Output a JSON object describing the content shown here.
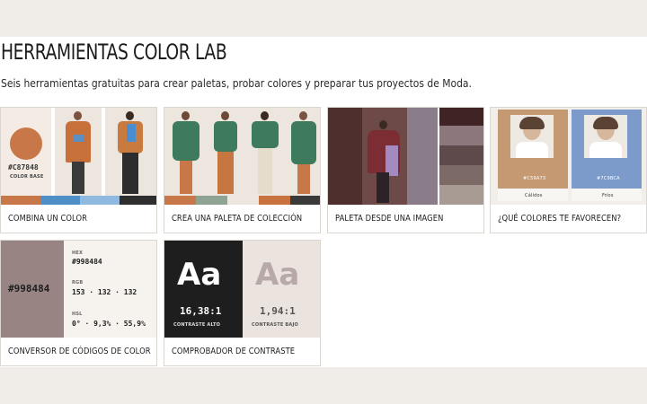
{
  "page": {
    "title": "HERRAMIENTAS COLOR LAB",
    "subtitle": "Seis herramientas gratuitas para crear paletas, probar colores y preparar tus proyectos de Moda."
  },
  "cards": [
    {
      "label": "COMBINA UN COLOR",
      "hex": "#C87848",
      "base": "COLOR BASE"
    },
    {
      "label": "CREA UNA PALETA DE COLECCIÓN"
    },
    {
      "label": "PALETA DESDE UNA IMAGEN"
    },
    {
      "label": "¿QUÉ COLORES TE FAVORECEN?",
      "warm_code": "#C59A73",
      "warm_label": "Cálidos",
      "cool_code": "#7C9BCA",
      "cool_label": "Fríos"
    },
    {
      "label": "CONVERSOR DE CÓDIGOS DE COLOR",
      "swatch_hex": "#998484",
      "hex_title": "HEX",
      "hex_value": "#998484",
      "rgb_title": "RGB",
      "rgb_value": "153 · 132 · 132",
      "hsl_title": "HSL",
      "hsl_value": "0° · 9,3% · 55,9%"
    },
    {
      "label": "COMPROBADOR DE CONTRASTE",
      "sample": "Aa",
      "high_ratio": "16,38:1",
      "high_label": "CONTRASTE ALTO",
      "low_ratio": "1,94:1",
      "low_label": "CONTRASTE BAJO"
    }
  ],
  "colors": {
    "background": "#f0ece8",
    "terracotta": "#C87848",
    "green": "#3f7a5f",
    "blue": "#4f8fc8",
    "mauve": "#998484",
    "dark": "#1e1e1e"
  }
}
